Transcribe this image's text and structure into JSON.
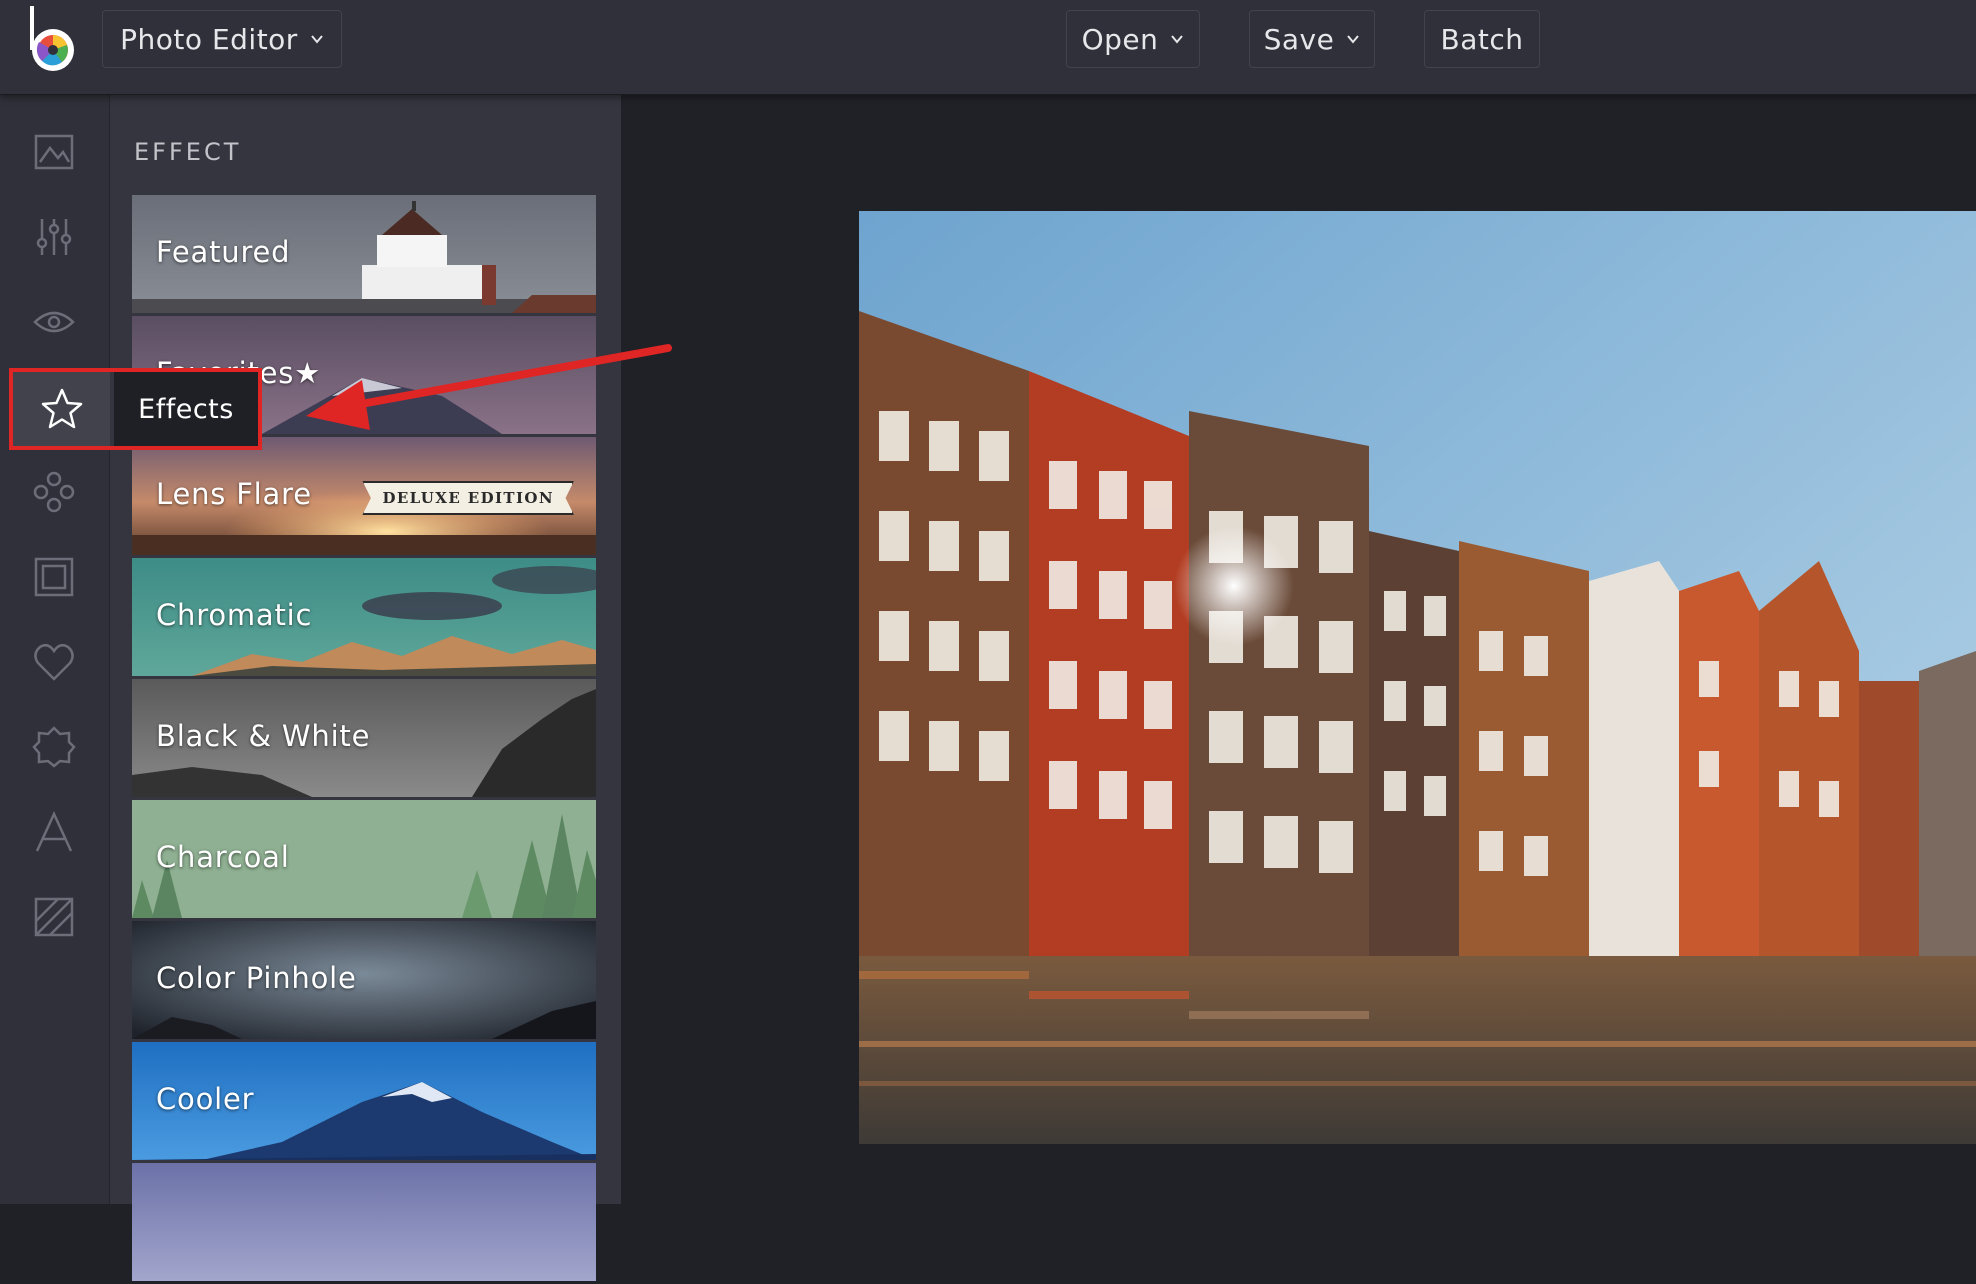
{
  "app": {
    "mode_label": "Photo Editor",
    "open_label": "Open",
    "save_label": "Save",
    "batch_label": "Batch"
  },
  "rail": {
    "icons": [
      "image-icon",
      "sliders-icon",
      "eye-icon",
      "star-icon",
      "butterfly-icon",
      "frame-icon",
      "heart-icon",
      "badge-icon",
      "text-icon",
      "texture-icon"
    ],
    "tooltip": "Effects"
  },
  "panel": {
    "title": "EFFECT",
    "deluxe_badge": "DELUXE EDITION",
    "effects": [
      {
        "label": "Featured"
      },
      {
        "label": "Favorites★"
      },
      {
        "label": "Lens Flare"
      },
      {
        "label": "Chromatic"
      },
      {
        "label": "Black & White"
      },
      {
        "label": "Charcoal"
      },
      {
        "label": "Color Pinhole"
      },
      {
        "label": "Cooler"
      },
      {
        "label": ""
      }
    ]
  },
  "colors": {
    "highlight": "#e02525",
    "topbar": "#2f3039",
    "panel": "#34353e",
    "canvas": "#202127"
  }
}
